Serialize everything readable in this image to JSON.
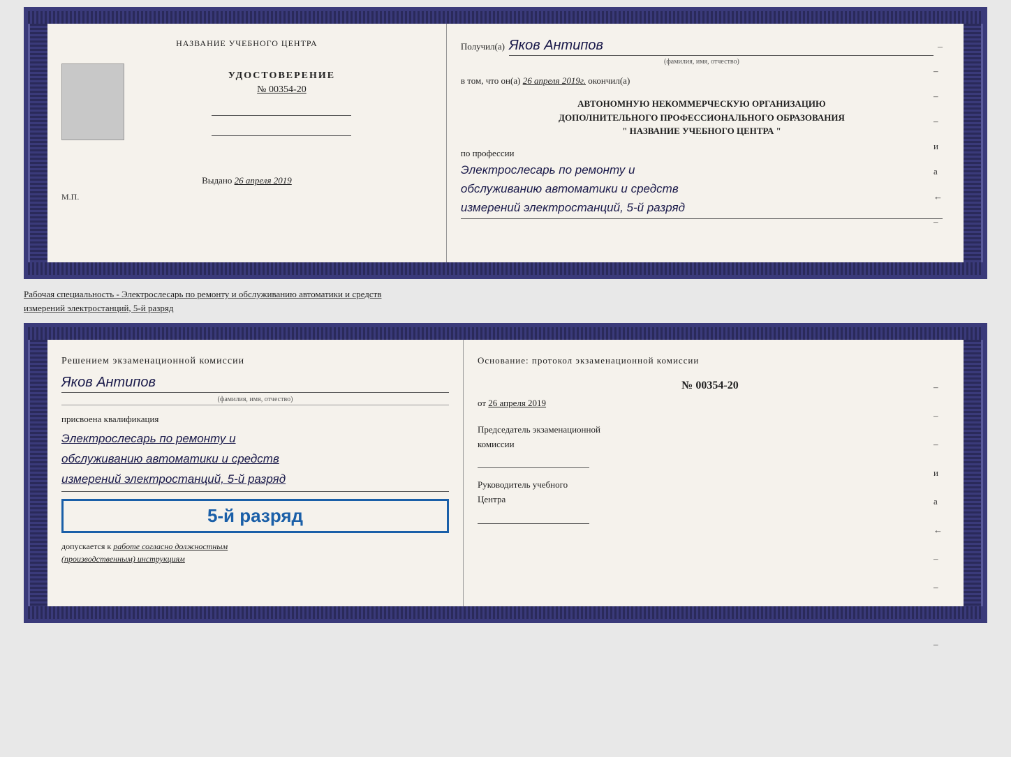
{
  "top_doc": {
    "left": {
      "org_name": "НАЗВАНИЕ УЧЕБНОГО ЦЕНТРА",
      "doc_type": "УДОСТОВЕРЕНИЕ",
      "doc_number": "№ 00354-20",
      "issued_label": "Выдано",
      "issued_date": "26 апреля 2019",
      "mp_label": "М.П."
    },
    "right": {
      "recipient_prefix": "Получил(а)",
      "recipient_name": "Яков Антипов",
      "recipient_subtitle": "(фамилия, имя, отчество)",
      "body_line1": "в том, что он(а)",
      "cert_date": "26 апреля 2019г.",
      "body_okончил": "окончил(а)",
      "org_line1": "АВТОНОМНУЮ НЕКОММЕРЧЕСКУЮ ОРГАНИЗАЦИЮ",
      "org_line2": "ДОПОЛНИТЕЛЬНОГО ПРОФЕССИОНАЛЬНОГО ОБРАЗОВАНИЯ",
      "org_line3": "\" НАЗВАНИЕ УЧЕБНОГО ЦЕНТРА \"",
      "profession_label": "по профессии",
      "profession_line1": "Электрослесарь по ремонту и",
      "profession_line2": "обслуживанию автоматики и средств",
      "profession_line3": "измерений электростанций, 5-й разряд",
      "dashes": [
        "-",
        "-",
        "-",
        "и",
        "а",
        "←",
        "-"
      ]
    }
  },
  "annotation": {
    "line1": "Рабочая специальность - Электрослесарь по ремонту и обслуживанию автоматики и средств",
    "line2": "измерений электростанций, 5-й разряд"
  },
  "bottom_doc": {
    "left": {
      "resolution_title": "Решением  экзаменационной  комиссии",
      "name": "Яков Антипов",
      "name_subtitle": "(фамилия, имя, отчество)",
      "assigned_label": "присвоена квалификация",
      "qual_line1": "Электрослесарь по ремонту и",
      "qual_line2": "обслуживанию автоматики и средств",
      "qual_line3": "измерений электростанций, 5-й разряд",
      "grade_badge": "5-й разряд",
      "allow_label": "допускается к",
      "allow_text": "работе согласно должностным",
      "allow_text2": "(производственным) инструкциям"
    },
    "right": {
      "basis_label": "Основание:  протокол  экзаменационной  комиссии",
      "number": "№  00354-20",
      "date_prefix": "от",
      "date": "26 апреля 2019",
      "chairman_label": "Председатель экзаменационной",
      "chairman_label2": "комиссии",
      "director_label": "Руководитель учебного",
      "director_label2": "Центра",
      "dashes": [
        "-",
        "-",
        "-",
        "и",
        "а",
        "←",
        "-",
        "-",
        "-",
        "-"
      ]
    }
  }
}
